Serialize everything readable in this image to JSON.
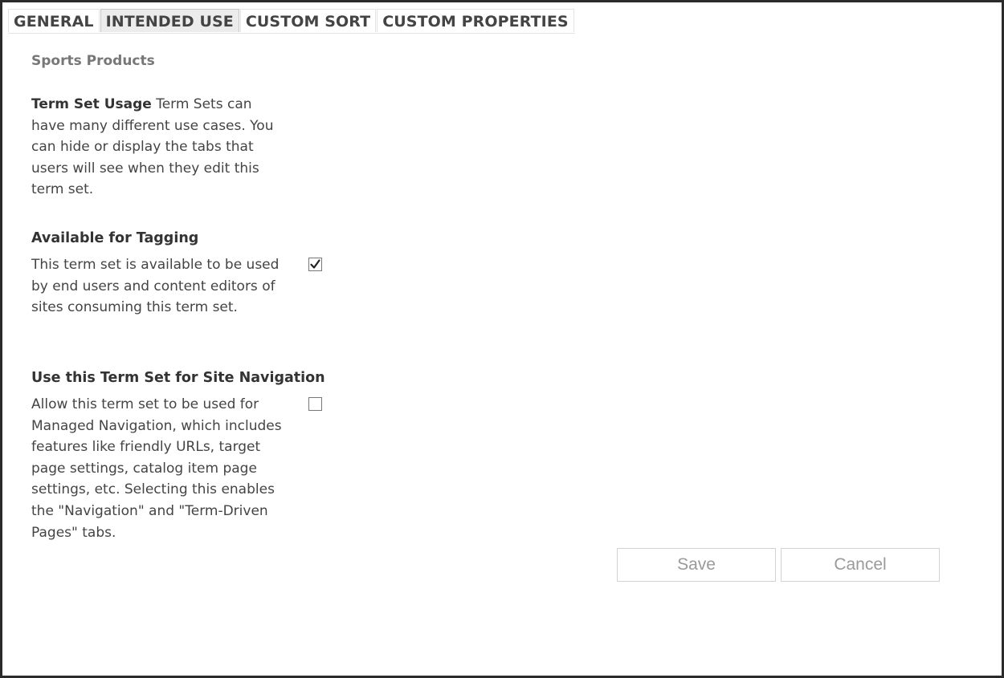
{
  "tabs": [
    {
      "label": "GENERAL",
      "active": false
    },
    {
      "label": "INTENDED USE",
      "active": true
    },
    {
      "label": "CUSTOM SORT",
      "active": false
    },
    {
      "label": "CUSTOM PROPERTIES",
      "active": false
    }
  ],
  "term_set_name": "Sports Products",
  "usage": {
    "lead": "Term Set Usage",
    "text": "Term Sets can have many different use cases. You can hide or display the tabs that users will see when they edit this term set."
  },
  "tagging": {
    "heading": "Available for Tagging",
    "description": "This term set is available to be used by end users and content editors of sites consuming this term set.",
    "checked": true
  },
  "navigation": {
    "heading": "Use this Term Set for Site Navigation",
    "description": "Allow this term set to be used for Managed Navigation, which includes features like friendly URLs, target page settings, catalog item page settings, etc. Selecting this enables the \"Navigation\" and \"Term-Driven Pages\" tabs.",
    "checked": false
  },
  "buttons": {
    "save": "Save",
    "cancel": "Cancel"
  }
}
